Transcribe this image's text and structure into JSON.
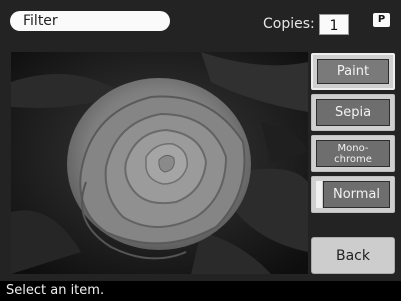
{
  "header": {
    "title": "Filter",
    "copies_label": "Copies:",
    "copies_value": "1",
    "badge": "P"
  },
  "buttons": {
    "paint": "Paint",
    "sepia": "Sepia",
    "mono": "Mono-\nchrome",
    "normal": "Normal",
    "back": "Back"
  },
  "status": {
    "message": "Select an item."
  },
  "colors": {
    "background": "#232323",
    "button_face": "#6e6e6e",
    "highlight": "#fafafa"
  }
}
